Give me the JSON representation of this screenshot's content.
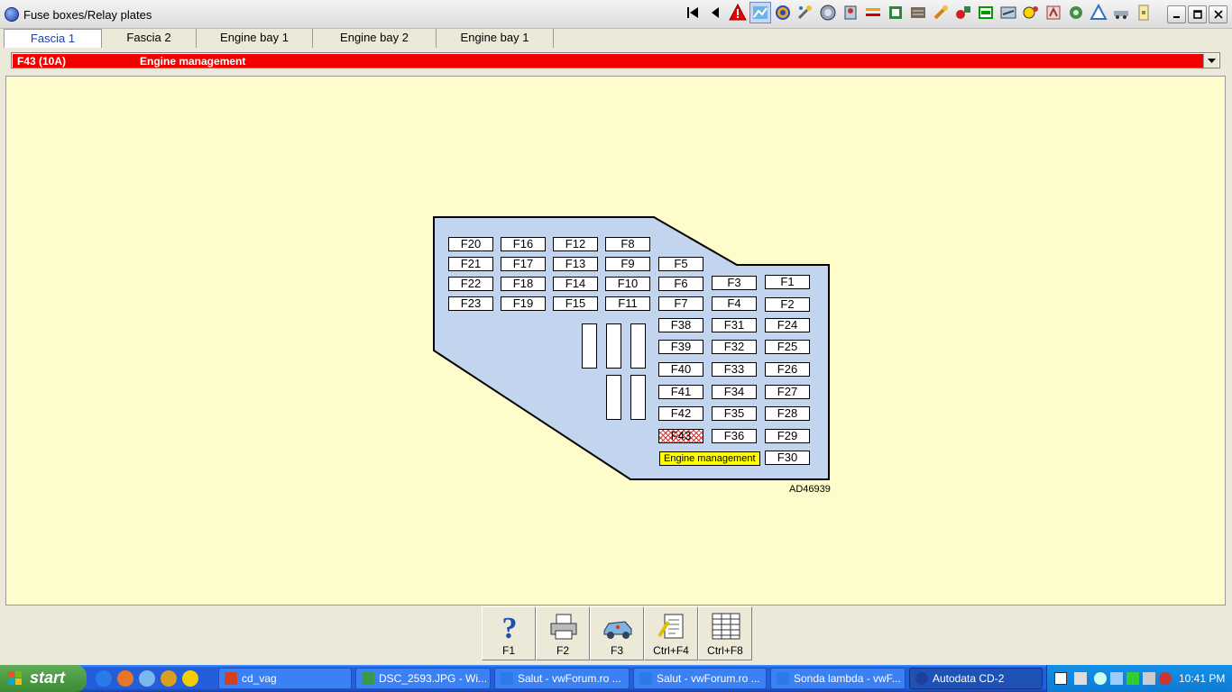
{
  "window": {
    "title": "Fuse boxes/Relay plates"
  },
  "tabs": [
    {
      "label": "Fascia 1",
      "active": true
    },
    {
      "label": "Fascia 2",
      "active": false
    },
    {
      "label": "Engine bay 1",
      "active": false
    },
    {
      "label": "Engine bay 2",
      "active": false
    },
    {
      "label": "Engine bay 1",
      "active": false
    }
  ],
  "selection": {
    "code": "F43 (10A)",
    "description": "Engine management",
    "color": "#f20000"
  },
  "fuses": {
    "F20": "F20",
    "F16": "F16",
    "F12": "F12",
    "F8": "F8",
    "F21": "F21",
    "F17": "F17",
    "F13": "F13",
    "F9": "F9",
    "F5": "F5",
    "F22": "F22",
    "F18": "F18",
    "F14": "F14",
    "F10": "F10",
    "F6": "F6",
    "F3": "F3",
    "F1": "F1",
    "F23": "F23",
    "F19": "F19",
    "F15": "F15",
    "F11": "F11",
    "F7": "F7",
    "F4": "F4",
    "F2": "F2",
    "F38": "F38",
    "F31": "F31",
    "F24": "F24",
    "F39": "F39",
    "F32": "F32",
    "F25": "F25",
    "F40": "F40",
    "F33": "F33",
    "F26": "F26",
    "F41": "F41",
    "F34": "F34",
    "F27": "F27",
    "F42": "F42",
    "F35": "F35",
    "F28": "F28",
    "F43": "F43",
    "F36": "F36",
    "F29": "F29",
    "F30": "F30"
  },
  "diagram": {
    "tooltip": "Engine management",
    "reference": "AD46939",
    "plate_color": "#c3d4ee",
    "background_color": "#fffccc"
  },
  "function_keys": [
    {
      "label": "F1",
      "icon": "help-icon"
    },
    {
      "label": "F2",
      "icon": "printer-icon"
    },
    {
      "label": "F3",
      "icon": "car-icon"
    },
    {
      "label": "Ctrl+F4",
      "icon": "notes-icon"
    },
    {
      "label": "Ctrl+F8",
      "icon": "table-icon"
    }
  ],
  "taskbar": {
    "start_label": "start",
    "tasks": [
      {
        "label": "cd_vag",
        "active": false
      },
      {
        "label": "DSC_2593.JPG - Wi...",
        "active": false
      },
      {
        "label": "Salut - vwForum.ro ...",
        "active": false
      },
      {
        "label": "Salut - vwForum.ro ...",
        "active": false
      },
      {
        "label": "Sonda lambda - vwF...",
        "active": false
      },
      {
        "label": "Autodata CD-2",
        "active": true
      }
    ],
    "clock": "10:41 PM"
  }
}
